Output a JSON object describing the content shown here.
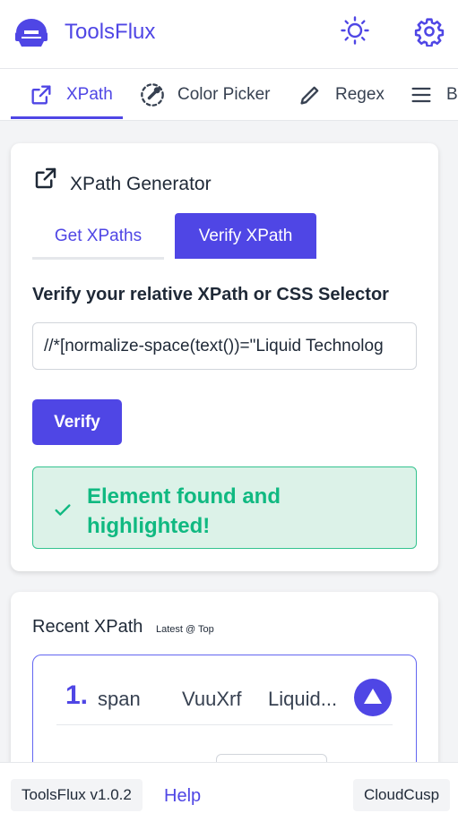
{
  "app": {
    "title": "ToolsFlux"
  },
  "colors": {
    "accent": "#4f46e5",
    "success": "#10b981",
    "success_bg": "#dcf2e8"
  },
  "header": {
    "theme_icon": "sun-icon",
    "settings_icon": "gear-icon"
  },
  "nav": {
    "tabs": [
      {
        "label": "XPath",
        "icon": "external-link-icon",
        "active": true
      },
      {
        "label": "Color Picker",
        "icon": "color-picker-icon",
        "active": false
      },
      {
        "label": "Regex",
        "icon": "pencil-icon",
        "active": false
      },
      {
        "label": "Ba",
        "icon": "menu-icon",
        "active": false
      }
    ]
  },
  "generator": {
    "title": "XPath Generator",
    "tabs": {
      "get": "Get XPaths",
      "verify": "Verify XPath"
    },
    "verify_label": "Verify your relative XPath or CSS Selector",
    "input_value": "//*[normalize-space(text())=\"Liquid Technolog",
    "verify_button": "Verify",
    "result_message": "Element found and highlighted!"
  },
  "recent": {
    "title": "Recent XPath",
    "subtitle": "Latest @ Top",
    "items": [
      {
        "index": "1.",
        "tag": "span",
        "attr": "VuuXrf",
        "text": "Liquid..."
      }
    ]
  },
  "footer": {
    "version": "ToolsFlux v1.0.2",
    "help": "Help",
    "brand": "CloudCusp"
  }
}
